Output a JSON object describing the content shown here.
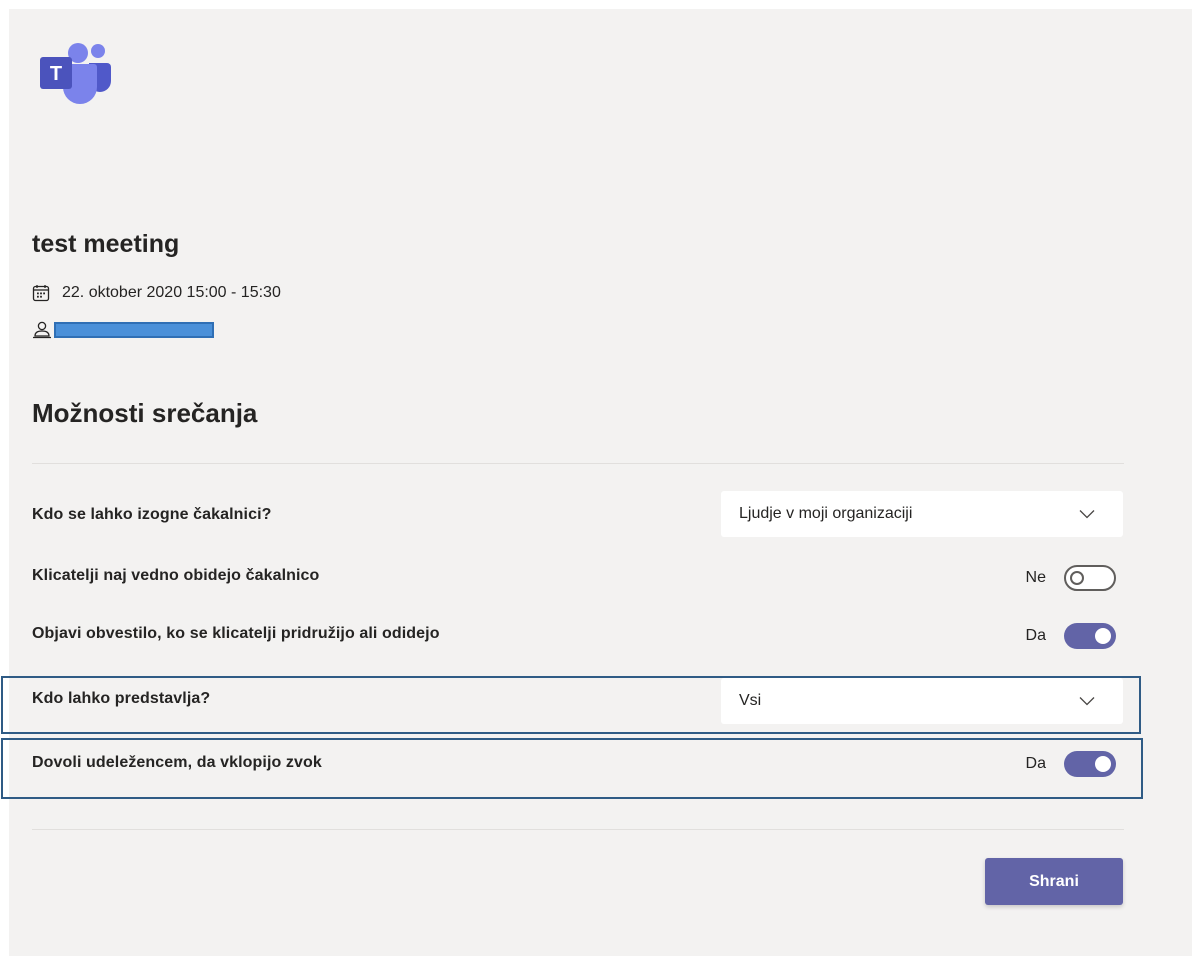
{
  "app": {
    "logo_icon": "microsoft-teams-logo",
    "logo_letter": "T"
  },
  "meeting": {
    "title": "test meeting",
    "date_icon": "calendar-icon",
    "datetime": "22. oktober 2020 15:00 - 15:30",
    "organizer_icon": "person-icon"
  },
  "options": {
    "heading": "Možnosti srečanja",
    "lobby_bypass": {
      "label": "Kdo se lahko izogne čakalnici?",
      "value": "Ljudje v moji organizaciji"
    },
    "callers_bypass": {
      "label": "Klicatelji naj vedno obidejo čakalnico",
      "state_text": "Ne",
      "on": false
    },
    "announce": {
      "label": "Objavi obvestilo, ko se klicatelji pridružijo ali odidejo",
      "state_text": "Da",
      "on": true
    },
    "presenters": {
      "label": "Kdo lahko predstavlja?",
      "value": "Vsi"
    },
    "unmute": {
      "label": "Dovoli udeležencem, da vklopijo zvok",
      "state_text": "Da",
      "on": true
    }
  },
  "actions": {
    "save_label": "Shrani"
  },
  "colors": {
    "accent": "#6264a7",
    "highlight_border": "#2f5b85",
    "redaction": "#4a90d9"
  }
}
